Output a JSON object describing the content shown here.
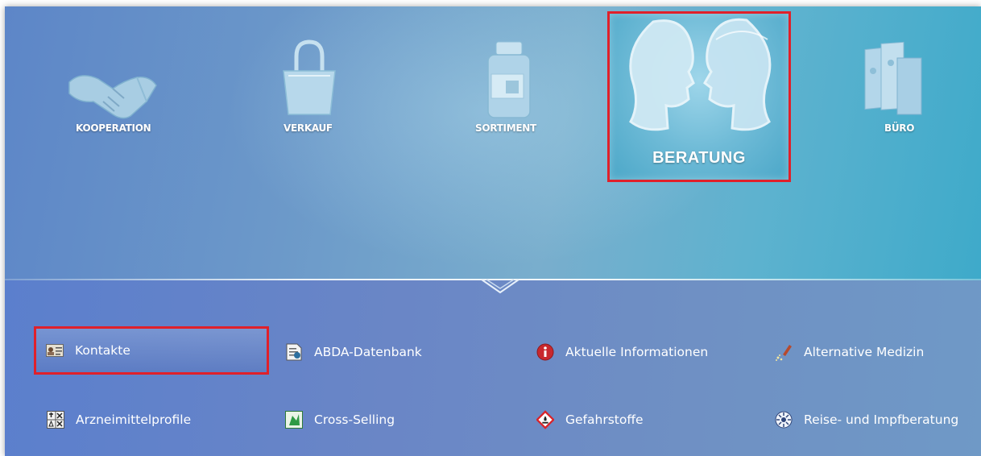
{
  "categories": [
    {
      "id": "kooperation",
      "label": "KOOPERATION",
      "icon": "handshake-icon"
    },
    {
      "id": "verkauf",
      "label": "VERKAUF",
      "icon": "shopping-bag-icon"
    },
    {
      "id": "sortiment",
      "label": "SORTIMENT",
      "icon": "medicine-jar-icon"
    },
    {
      "id": "beratung",
      "label": "BERATUNG",
      "icon": "consultation-faces-icon",
      "selected": true
    },
    {
      "id": "buero",
      "label": "BÜRO",
      "icon": "binders-icon"
    }
  ],
  "submenu": [
    {
      "label": "Kontakte",
      "icon": "contact-card-icon",
      "selected": true
    },
    {
      "label": "ABDA-Datenbank",
      "icon": "database-document-icon"
    },
    {
      "label": "Aktuelle Informationen",
      "icon": "info-icon"
    },
    {
      "label": "Alternative Medizin",
      "icon": "mortar-herbs-icon"
    },
    {
      "label": "Arzneimittelprofile",
      "icon": "profile-grid-icon"
    },
    {
      "label": "Cross-Selling",
      "icon": "cross-selling-icon"
    },
    {
      "label": "Gefahrstoffe",
      "icon": "hazard-diamond-icon"
    },
    {
      "label": "Reise- und Impfberatung",
      "icon": "travel-vaccine-icon"
    }
  ],
  "colors": {
    "highlight_border": "#e0202a",
    "text": "#ffffff",
    "info_red": "#c8282e",
    "hazard_red": "#d9232a"
  }
}
